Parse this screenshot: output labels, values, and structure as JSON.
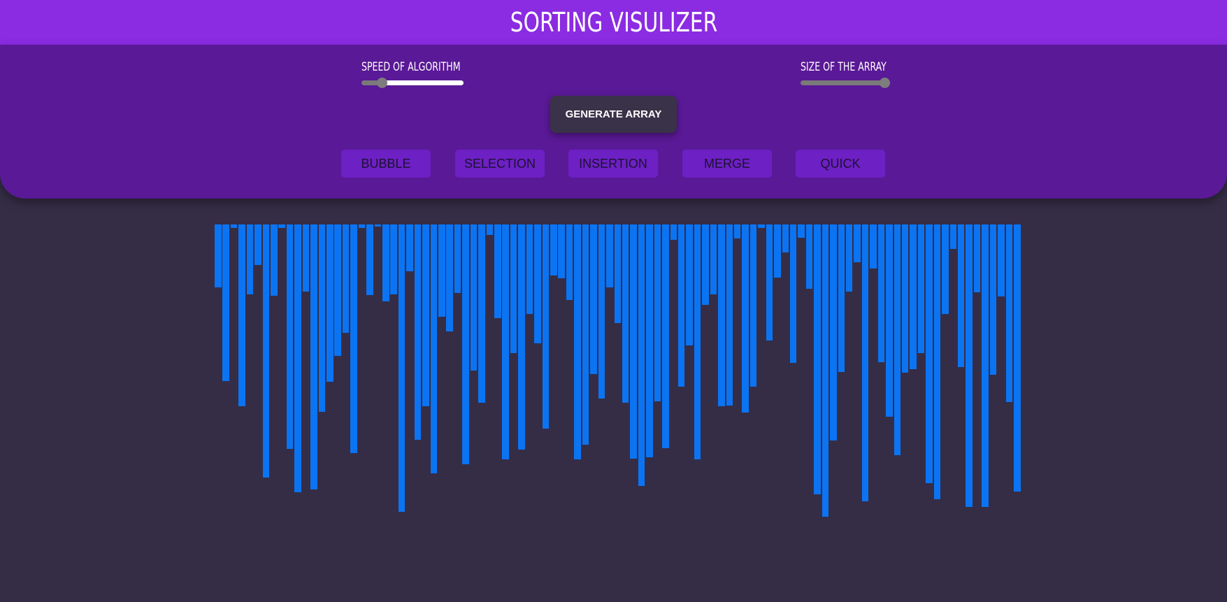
{
  "header": {
    "title": "SORTING VISULIZER"
  },
  "controls": {
    "speed": {
      "label": "SPEED OF ALGORITHM",
      "value_fraction": 0.17
    },
    "size": {
      "label": "SIZE OF THE ARRAY",
      "value_fraction": 1.0
    },
    "generate_label": "GENERATE ARRAY",
    "algorithms": [
      {
        "id": "bubble",
        "label": "BUBBLE"
      },
      {
        "id": "selection",
        "label": "SELECTION"
      },
      {
        "id": "insertion",
        "label": "INSERTION"
      },
      {
        "id": "merge",
        "label": "MERGE"
      },
      {
        "id": "quick",
        "label": "QUICK"
      }
    ]
  },
  "array": {
    "bar_color": "#0b74f3",
    "values": [
      90,
      224,
      5,
      260,
      100,
      58,
      362,
      102,
      5,
      321,
      383,
      96,
      379,
      268,
      225,
      188,
      155,
      327,
      5,
      101,
      3,
      110,
      100,
      411,
      67,
      308,
      260,
      356,
      132,
      153,
      98,
      343,
      209,
      255,
      15,
      134,
      336,
      184,
      322,
      128,
      170,
      292,
      73,
      77,
      108,
      336,
      315,
      214,
      249,
      90,
      141,
      255,
      335,
      374,
      333,
      253,
      320,
      22,
      232,
      173,
      336,
      115,
      100,
      260,
      259,
      20,
      269,
      232,
      5,
      166,
      76,
      40,
      198,
      19,
      92,
      386,
      418,
      309,
      211,
      96,
      54,
      396,
      63,
      197,
      275,
      330,
      212,
      207,
      184,
      370,
      393,
      128,
      35,
      204,
      404,
      97,
      404,
      215,
      103,
      254,
      382
    ]
  }
}
